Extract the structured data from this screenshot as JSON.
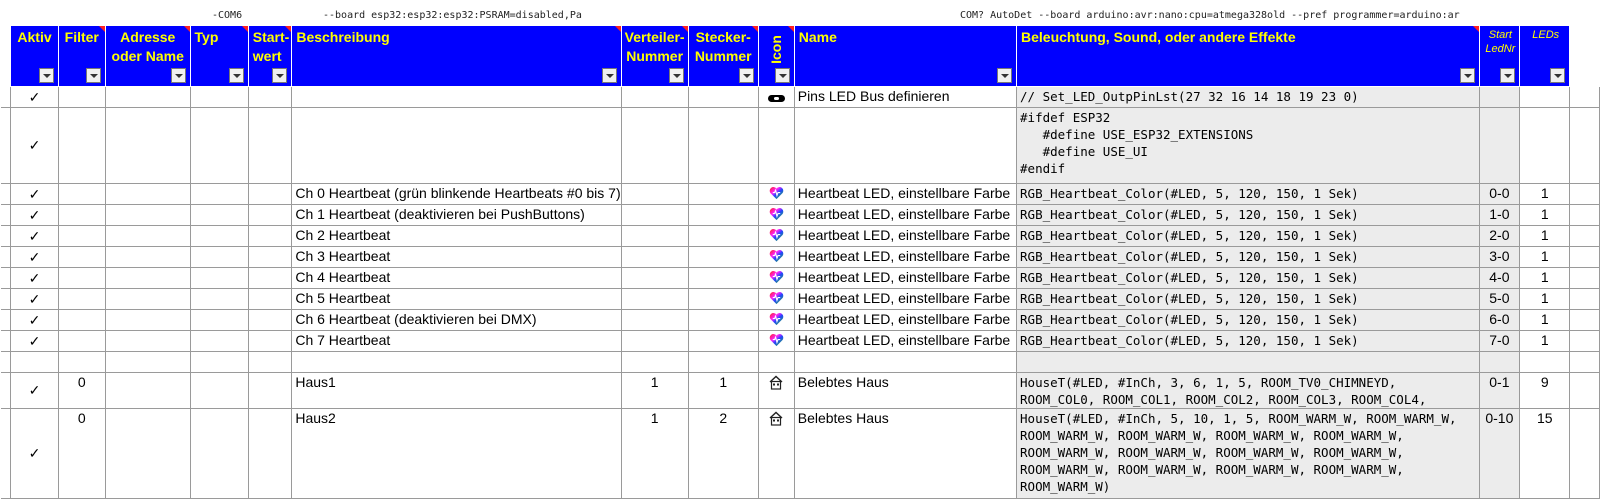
{
  "pre": {
    "com6": "-COM6",
    "board_esp32": "--board esp32:esp32:esp32:PSRAM=disabled,Pa",
    "com_auto": "COM? AutoDet --board arduino:avr:nano:cpu=atmega328old --pref programmer=arduino:ar"
  },
  "headers": {
    "aktiv": "Aktiv",
    "filter": "Filter",
    "adresse": "Adresse oder Name",
    "typ": "Typ",
    "startwert": "Start-wert",
    "beschreibung": "Beschreibung",
    "verteiler": "Verteiler-Nummer",
    "stecker": "Stecker-Nummer",
    "icon": "Icon",
    "name": "Name",
    "effekte": "Beleuchtung, Sound, oder andere Effekte",
    "start_led": "Start LedNr",
    "leds": "LEDs"
  },
  "colors": {
    "header_bg": "#0000ff",
    "header_fg": "#ffff00"
  },
  "rows": [
    {
      "aktiv": "✓",
      "filter": "",
      "beschreibung": "",
      "verteiler": "",
      "stecker": "",
      "icon": "pill-icon",
      "name": "Pins LED Bus definieren",
      "code": "// Set_LED_OutpPinLst(27 32 16 14 18 19 23 0)",
      "start": "",
      "leds": ""
    },
    {
      "aktiv": "✓",
      "filter": "",
      "beschreibung": "",
      "verteiler": "",
      "stecker": "",
      "icon": "",
      "name": "",
      "code": "#ifdef ESP32\n   #define USE_ESP32_EXTENSIONS\n   #define USE_UI\n#endif",
      "start": "",
      "leds": ""
    },
    {
      "aktiv": "✓",
      "filter": "",
      "beschreibung": "Ch 0 Heartbeat (grün blinkende Heartbeats #0 bis 7)",
      "verteiler": "",
      "stecker": "",
      "icon": "heart-icon",
      "name": "Heartbeat LED, einstellbare Farbe",
      "code": "RGB_Heartbeat_Color(#LED, 5, 120, 150, 1 Sek)",
      "start": "0-0",
      "leds": "1"
    },
    {
      "aktiv": "✓",
      "filter": "",
      "beschreibung": "Ch 1 Heartbeat (deaktivieren bei PushButtons)",
      "verteiler": "",
      "stecker": "",
      "icon": "heart-icon",
      "name": "Heartbeat LED, einstellbare Farbe",
      "code": "RGB_Heartbeat_Color(#LED, 5, 120, 150, 1 Sek)",
      "start": "1-0",
      "leds": "1"
    },
    {
      "aktiv": "✓",
      "filter": "",
      "beschreibung": "Ch 2 Heartbeat",
      "verteiler": "",
      "stecker": "",
      "icon": "heart-icon",
      "name": "Heartbeat LED, einstellbare Farbe",
      "code": "RGB_Heartbeat_Color(#LED, 5, 120, 150, 1 Sek)",
      "start": "2-0",
      "leds": "1"
    },
    {
      "aktiv": "✓",
      "filter": "",
      "beschreibung": "Ch 3 Heartbeat",
      "verteiler": "",
      "stecker": "",
      "icon": "heart-icon",
      "name": "Heartbeat LED, einstellbare Farbe",
      "code": "RGB_Heartbeat_Color(#LED, 5, 120, 150, 1 Sek)",
      "start": "3-0",
      "leds": "1"
    },
    {
      "aktiv": "✓",
      "filter": "",
      "beschreibung": "Ch 4 Heartbeat",
      "verteiler": "",
      "stecker": "",
      "icon": "heart-icon",
      "name": "Heartbeat LED, einstellbare Farbe",
      "code": "RGB_Heartbeat_Color(#LED, 5, 120, 150, 1 Sek)",
      "start": "4-0",
      "leds": "1"
    },
    {
      "aktiv": "✓",
      "filter": "",
      "beschreibung": "Ch 5 Heartbeat",
      "verteiler": "",
      "stecker": "",
      "icon": "heart-icon",
      "name": "Heartbeat LED, einstellbare Farbe",
      "code": "RGB_Heartbeat_Color(#LED, 5, 120, 150, 1 Sek)",
      "start": "5-0",
      "leds": "1"
    },
    {
      "aktiv": "✓",
      "filter": "",
      "beschreibung": "Ch 6 Heartbeat (deaktivieren bei DMX)",
      "verteiler": "",
      "stecker": "",
      "icon": "heart-icon",
      "name": "Heartbeat LED, einstellbare Farbe",
      "code": "RGB_Heartbeat_Color(#LED, 5, 120, 150, 1 Sek)",
      "start": "6-0",
      "leds": "1"
    },
    {
      "aktiv": "✓",
      "filter": "",
      "beschreibung": "Ch 7 Heartbeat",
      "verteiler": "",
      "stecker": "",
      "icon": "heart-icon",
      "name": "Heartbeat LED, einstellbare Farbe",
      "code": "RGB_Heartbeat_Color(#LED, 5, 120, 150, 1 Sek)",
      "start": "7-0",
      "leds": "1"
    },
    {
      "aktiv": "",
      "filter": "",
      "beschreibung": "",
      "verteiler": "",
      "stecker": "",
      "icon": "",
      "name": "",
      "code": "",
      "start": "",
      "leds": ""
    },
    {
      "aktiv": "✓",
      "filter": "0",
      "beschreibung": "Haus1",
      "verteiler": "1",
      "stecker": "1",
      "icon": "house-icon",
      "name": "Belebtes Haus",
      "code": "HouseT(#LED, #InCh, 3, 6, 1, 5, ROOM_TV0_CHIMNEYD,\nROOM_COL0, ROOM_COL1, ROOM_COL2, ROOM_COL3, ROOM_COL4,",
      "start": "0-1",
      "leds": "9"
    },
    {
      "aktiv": "✓",
      "filter": "0",
      "beschreibung": "Haus2",
      "verteiler": "1",
      "stecker": "2",
      "icon": "house-icon",
      "name": "Belebtes Haus",
      "code": "HouseT(#LED, #InCh, 5, 10, 1, 5, ROOM_WARM_W, ROOM_WARM_W,\nROOM_WARM_W, ROOM_WARM_W, ROOM_WARM_W, ROOM_WARM_W,\nROOM_WARM_W, ROOM_WARM_W, ROOM_WARM_W, ROOM_WARM_W,\nROOM_WARM_W, ROOM_WARM_W, ROOM_WARM_W, ROOM_WARM_W,\nROOM_WARM_W)",
      "start": "0-10",
      "leds": "15"
    }
  ]
}
